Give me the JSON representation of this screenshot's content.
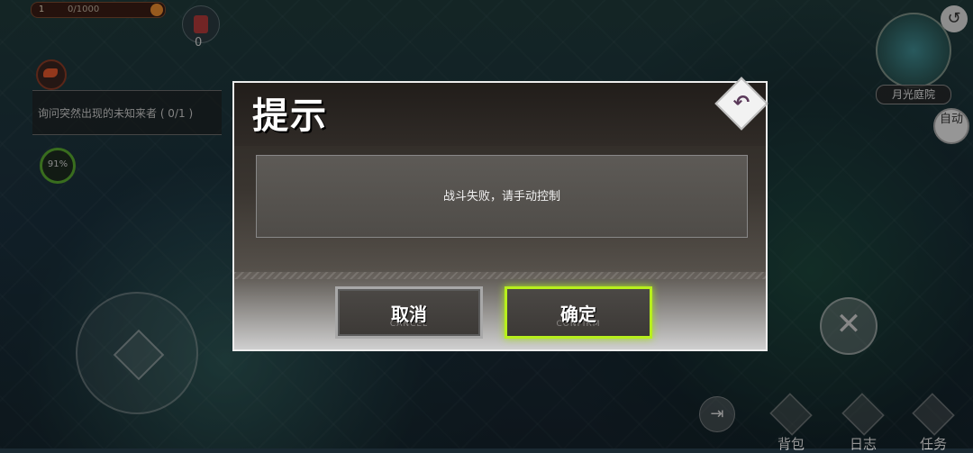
{
  "hud": {
    "level": "1",
    "xp": "0/1000",
    "bomb_count": "0",
    "quest_text": "询问突然出现的未知来者 ( 0/1 )",
    "progress": "91%",
    "map_name": "月光庭院",
    "auto_label": "自动"
  },
  "bottom_menu": [
    {
      "label": "背包"
    },
    {
      "label": "日志"
    },
    {
      "label": "任务"
    }
  ],
  "dialog": {
    "title": "提示",
    "message": "战斗失败，请手动控制",
    "cancel": {
      "label": "取消",
      "sub": "CANCEL"
    },
    "confirm": {
      "label": "确定",
      "sub": "CONFIRM"
    }
  },
  "colors": {
    "confirm_border": "#b7ef1c",
    "cancel_border": "#a8a8a8"
  }
}
